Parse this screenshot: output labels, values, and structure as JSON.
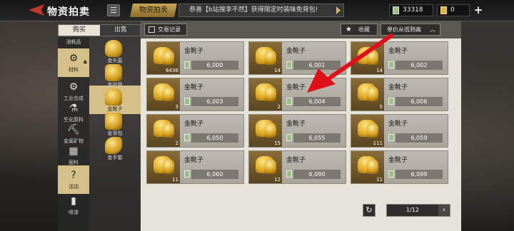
{
  "header": {
    "title": "物资拍卖",
    "current_tab": "物资拍卖",
    "marquee": "恭喜【b站搜李不然】获得限定时装味免背包!",
    "currency_green": "33318",
    "currency_gold": "0"
  },
  "buysell": {
    "buy": "购买",
    "sell": "出售"
  },
  "categories": [
    {
      "label": "消耗品",
      "icon": "flask-icon",
      "glyph": ""
    },
    {
      "label": "材料",
      "icon": "gear-material-icon",
      "glyph": "⚙"
    },
    {
      "label": "工业合成",
      "icon": "industry-icon",
      "glyph": "⚙"
    },
    {
      "label": "生化原料",
      "icon": "flask-icon",
      "glyph": "⚗"
    },
    {
      "label": "金属矿物",
      "icon": "ore-icon",
      "glyph": "⛏"
    },
    {
      "label": "面料",
      "icon": "fabric-icon",
      "glyph": "▦"
    },
    {
      "label": "活动",
      "icon": "event-icon",
      "glyph": "?"
    },
    {
      "label": "喷漆",
      "icon": "spray-icon",
      "glyph": "▮"
    }
  ],
  "subcategories": [
    {
      "label": "金头盔"
    },
    {
      "label": "金护甲"
    },
    {
      "label": "金靴子"
    },
    {
      "label": "金背包"
    },
    {
      "label": "金手套"
    }
  ],
  "toolbar": {
    "trade_record": "交易记录",
    "favorites": "收藏",
    "sort": "单价从低到高"
  },
  "items": [
    {
      "name": "金靴子",
      "qty": "6436",
      "price": "6,000"
    },
    {
      "name": "金靴子",
      "qty": "14",
      "price": "6,001"
    },
    {
      "name": "金靴子",
      "qty": "14",
      "price": "6,002"
    },
    {
      "name": "金靴子",
      "qty": "3",
      "price": "6,003"
    },
    {
      "name": "金靴子",
      "qty": "2",
      "price": "6,004"
    },
    {
      "name": "金靴子",
      "qty": "5",
      "price": "6,006"
    },
    {
      "name": "金靴子",
      "qty": "2",
      "price": "6,050"
    },
    {
      "name": "金靴子",
      "qty": "15",
      "price": "6,055"
    },
    {
      "name": "金靴子",
      "qty": "111",
      "price": "6,059"
    },
    {
      "name": "金靴子",
      "qty": "11",
      "price": "6,060"
    },
    {
      "name": "金靴子",
      "qty": "12",
      "price": "6,090"
    },
    {
      "name": "金靴子",
      "qty": "11",
      "price": "6,099"
    }
  ],
  "pager": {
    "text": "1/12"
  },
  "colors": {
    "accent_gold": "#d5c089",
    "annotation_red": "#e0101a"
  }
}
